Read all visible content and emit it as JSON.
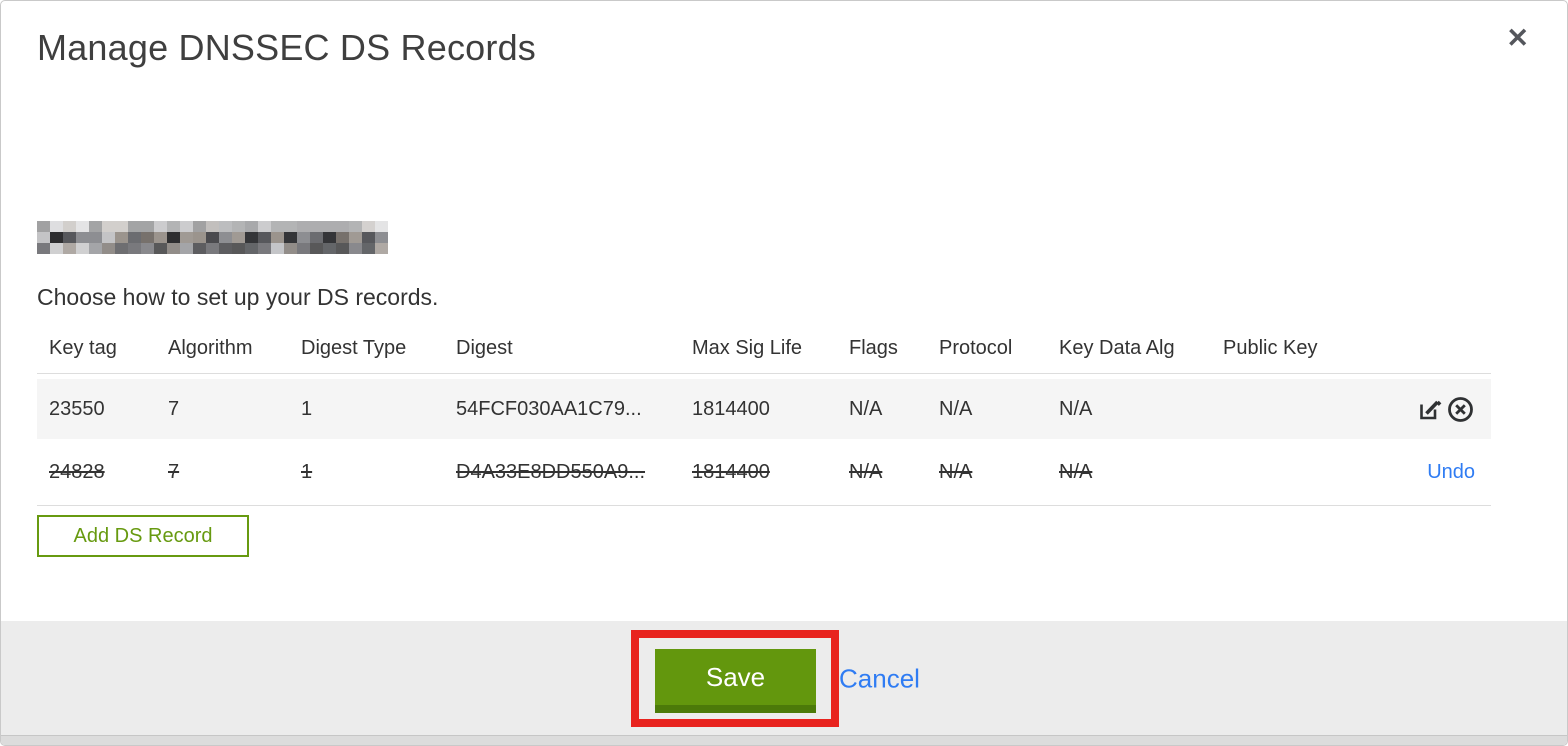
{
  "modal": {
    "title": "Manage DNSSEC DS Records",
    "close_icon": "✕",
    "instruction": "Choose how to set up your DS records.",
    "add_button_label": "Add DS Record"
  },
  "table": {
    "columns": [
      "Key tag",
      "Algorithm",
      "Digest Type",
      "Digest",
      "Max Sig Life",
      "Flags",
      "Protocol",
      "Key Data Alg",
      "Public Key"
    ],
    "rows": [
      {
        "key_tag": "23550",
        "algorithm": "7",
        "digest_type": "1",
        "digest": "54FCF030AA1C79...",
        "max_sig_life": "1814400",
        "flags": "N/A",
        "protocol": "N/A",
        "key_data_alg": "N/A",
        "public_key": "",
        "state": "editable"
      },
      {
        "key_tag": "24828",
        "algorithm": "7",
        "digest_type": "1",
        "digest": "D4A33E8DD550A9...",
        "max_sig_life": "1814400",
        "flags": "N/A",
        "protocol": "N/A",
        "key_data_alg": "N/A",
        "public_key": "",
        "state": "deleted",
        "undo_label": "Undo"
      }
    ]
  },
  "footer": {
    "save_label": "Save",
    "cancel_label": "Cancel"
  },
  "colors": {
    "accent_green": "#679a10",
    "save_green": "#63970d",
    "save_green_dark": "#4c7a09",
    "link_blue": "#2f7cf3",
    "annotation_red": "#e8231e",
    "row_highlight": "#f5f5f5",
    "footer_gray": "#ececec"
  }
}
